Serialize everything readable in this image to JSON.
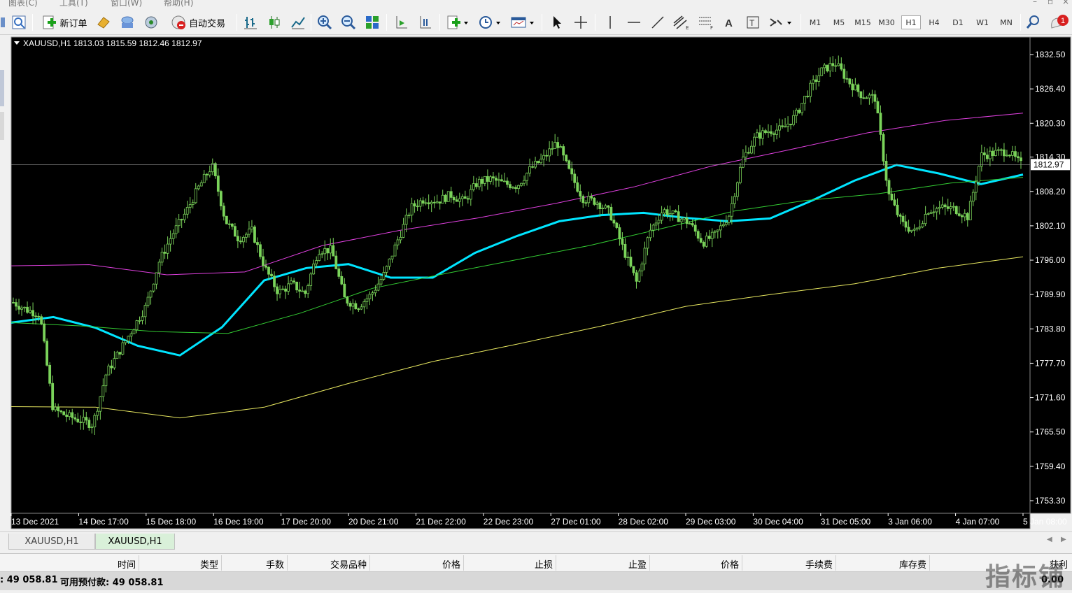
{
  "menu": {
    "items": [
      "图表(C)",
      "工具(T)",
      "窗口(W)",
      "帮助(H)"
    ],
    "window_controls": [
      "–",
      "▫",
      "×"
    ]
  },
  "toolbar": {
    "new_order_label": "新订单",
    "autotrade_label": "自动交易",
    "timeframes": [
      "M1",
      "M5",
      "M15",
      "M30",
      "H1",
      "H4",
      "D1",
      "W1",
      "MN"
    ],
    "active_timeframe": "H1",
    "alert_count": "1"
  },
  "chart": {
    "header": "XAUUSD,H1  1813.03 1815.59 1812.46 1812.97",
    "current_price_label": "1812.97",
    "background": "#000000",
    "candle_color": "#7ad35a",
    "price_ticks": [
      "1832.50",
      "1826.40",
      "1820.30",
      "1814.30",
      "1808.20",
      "1802.10",
      "1796.00",
      "1789.90",
      "1783.80",
      "1777.70",
      "1771.60",
      "1765.50",
      "1759.40",
      "1753.30"
    ],
    "time_ticks": [
      "13 Dec 2021",
      "14 Dec 17:00",
      "15 Dec 18:00",
      "16 Dec 19:00",
      "17 Dec 20:00",
      "20 Dec 21:00",
      "21 Dec 22:00",
      "22 Dec 23:00",
      "27 Dec 01:00",
      "28 Dec 02:00",
      "29 Dec 03:00",
      "30 Dec 04:00",
      "31 Dec 05:00",
      "3 Jan 06:00",
      "4 Jan 07:00",
      "5 Jan 08:00"
    ]
  },
  "chart_data": {
    "type": "line",
    "symbol": "XAUUSD",
    "timeframe": "H1",
    "ohlc_last": {
      "open": 1813.03,
      "high": 1815.59,
      "low": 1812.46,
      "close": 1812.97
    },
    "ylim": [
      1753.3,
      1832.5
    ],
    "x_labels": [
      "13 Dec 2021",
      "14 Dec 17:00",
      "15 Dec 18:00",
      "16 Dec 19:00",
      "17 Dec 20:00",
      "20 Dec 21:00",
      "21 Dec 22:00",
      "22 Dec 23:00",
      "27 Dec 01:00",
      "28 Dec 02:00",
      "29 Dec 03:00",
      "30 Dec 04:00",
      "31 Dec 05:00",
      "3 Jan 06:00",
      "4 Jan 07:00",
      "5 Jan 08:00"
    ],
    "price_path": [
      1788.5,
      1787.2,
      1786.4,
      1769.5,
      1768.4,
      1767.6,
      1766.8,
      1775.8,
      1779.8,
      1783.8,
      1787.8,
      1795.7,
      1800.6,
      1804.4,
      1809.0,
      1812.8,
      1803.0,
      1799.8,
      1801.2,
      1794.5,
      1790.2,
      1791.8,
      1790.0,
      1797.8,
      1797.8,
      1789.0,
      1787.8,
      1789.9,
      1793.6,
      1799.6,
      1805.3,
      1806.9,
      1806.5,
      1807.6,
      1806.4,
      1809.8,
      1810.4,
      1809.6,
      1809.2,
      1812.2,
      1814.1,
      1817.0,
      1811.3,
      1806.9,
      1806.4,
      1804.4,
      1798.0,
      1792.1,
      1801.1,
      1804.9,
      1803.8,
      1802.6,
      1799.1,
      1800.6,
      1804.1,
      1813.9,
      1817.9,
      1819.0,
      1819.2,
      1821.6,
      1826.2,
      1829.7,
      1831.0,
      1827.7,
      1825.3,
      1824.8,
      1807.8,
      1802.6,
      1800.9,
      1804.9,
      1805.3,
      1805.1,
      1803.7,
      1814.6,
      1815.0,
      1815.4,
      1812.97
    ],
    "series": [
      {
        "color": "#00e5ff",
        "values": [
          1784.9,
          1785.9,
          1784.0,
          1780.8,
          1779.1,
          1784.1,
          1792.4,
          1794.6,
          1795.3,
          1792.9,
          1792.9,
          1797.3,
          1800.3,
          1802.9,
          1804.0,
          1804.4,
          1803.5,
          1802.9,
          1803.4,
          1806.6,
          1810.1,
          1812.9,
          1811.4,
          1809.5,
          1811.2
        ]
      },
      {
        "color": "#33cc33",
        "values": [
          1784.9,
          1784.3,
          1783.3,
          1783.0,
          1786.6,
          1791.0,
          1793.6,
          1796.1,
          1798.6,
          1801.6,
          1804.7,
          1806.6,
          1807.8,
          1809.7,
          1810.7
        ]
      },
      {
        "color": "#e040e0",
        "values": [
          1795.0,
          1795.2,
          1793.4,
          1793.9,
          1798.6,
          1801.3,
          1803.5,
          1806.1,
          1809.0,
          1812.7,
          1815.6,
          1818.6,
          1820.8,
          1822.1
        ]
      },
      {
        "color": "#e8e860",
        "values": [
          1770.0,
          1769.9,
          1768.0,
          1769.9,
          1774.1,
          1778.0,
          1781.1,
          1784.3,
          1787.8,
          1789.9,
          1791.8,
          1794.6,
          1796.6
        ]
      }
    ]
  },
  "tabs": [
    "XAUUSD,H1",
    "XAUUSD,H1"
  ],
  "active_tab": 1,
  "terminal": {
    "columns": [
      "时间",
      "类型",
      "手数",
      "交易品种",
      "价格",
      "止损",
      "止盈",
      "价格",
      "手续费",
      "库存费",
      "获利"
    ]
  },
  "status": {
    "balance": ": 49 058.81",
    "free_margin": "可用预付款: 49 058.81",
    "profit": "0.00"
  },
  "watermark": "指标铺"
}
